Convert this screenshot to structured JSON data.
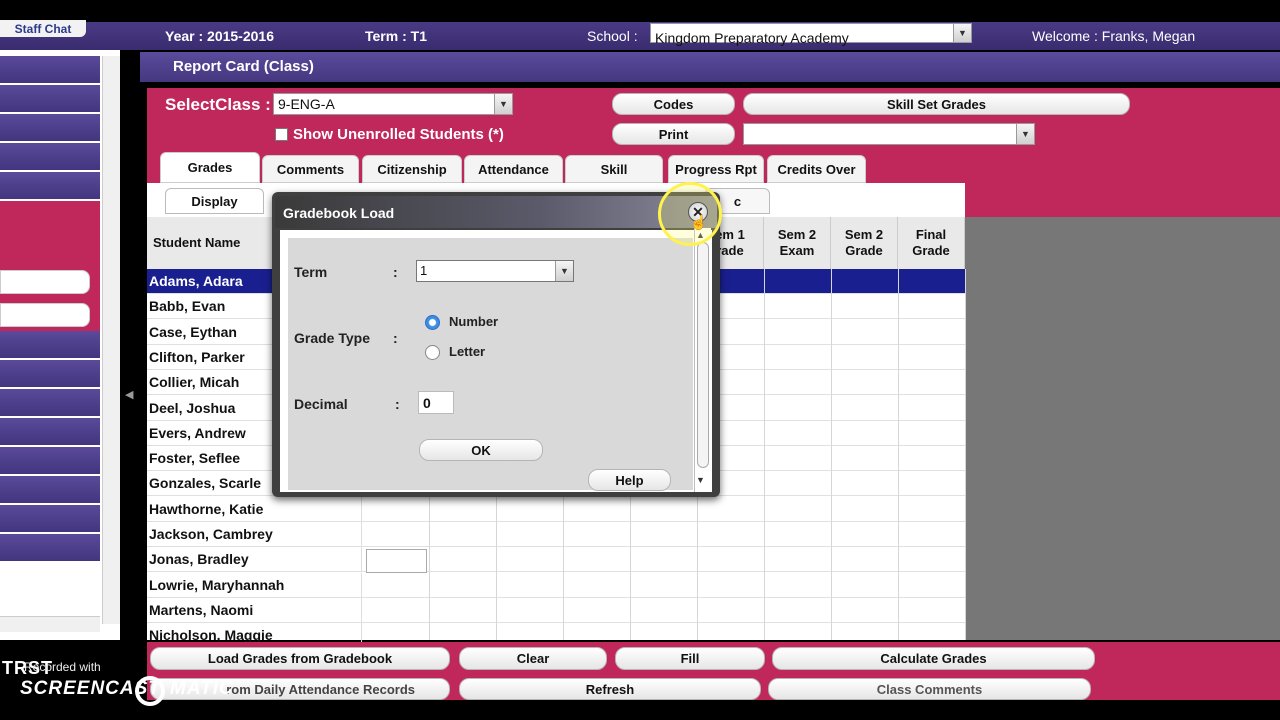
{
  "topbar": {
    "staff_chat": "Staff Chat",
    "year": "Year : 2015-2016",
    "term": "Term : T1",
    "school_label": "School :",
    "school_value": "Kingdom Preparatory Academy",
    "welcome": "Welcome : Franks, Megan"
  },
  "header": {
    "title": "Report Card (Class)"
  },
  "controls": {
    "select_class_label": "SelectClass :",
    "select_class_value": "9-ENG-A",
    "show_unenrolled": "Show Unenrolled Students (*)",
    "codes": "Codes",
    "skill_set_grades": "Skill Set Grades",
    "print": "Print"
  },
  "tabs": [
    "Grades",
    "Comments",
    "Citizenship",
    "Attendance",
    "Skill",
    "Progress Rpt",
    "Credits Over"
  ],
  "subtabs": {
    "display": "Display",
    "partial": "c"
  },
  "grid": {
    "student_name_header": "Student Name",
    "columns": [
      "Sem 1\nGrade",
      "Sem 2\nExam",
      "Sem 2\nGrade",
      "Final\nGrade"
    ],
    "partial_column": "em 1\nrade",
    "students": [
      "Adams, Adara",
      "Babb, Evan",
      "Case, Eythan",
      "Clifton, Parker",
      "Collier, Micah",
      "Deel, Joshua",
      "Evers, Andrew",
      "Foster, Seflee",
      "Gonzales, Scarle",
      "Hawthorne, Katie",
      "Jackson, Cambrey",
      "Jonas, Bradley",
      "Lowrie, Maryhannah",
      "Martens, Naomi",
      "Nicholson, Maggie"
    ],
    "selected_student": "Adams, Adara"
  },
  "bottom_buttons": {
    "load_gradebook": "Load Grades from Gradebook",
    "clear": "Clear",
    "fill": "Fill",
    "calculate": "Calculate Grades",
    "attendance": "rom Daily Attendance Records",
    "refresh": "Refresh",
    "class_comments": "Class Comments"
  },
  "dialog": {
    "title": "Gradebook Load",
    "term_label": "Term",
    "term_value": "1",
    "grade_type_label": "Grade Type",
    "colon": ":",
    "number": "Number",
    "letter": "Letter",
    "selected_grade_type": "Number",
    "decimal_label": "Decimal",
    "decimal_value": "0",
    "ok": "OK",
    "help": "Help",
    "close_icon": "close-icon"
  },
  "watermark": {
    "brand_partial": "TRST",
    "recorded_with": "Recorded with",
    "screencast": "SCREENCAST",
    "matic": "MATIC"
  },
  "colors": {
    "purple": "#45377f",
    "crimson": "#c0275a",
    "selected_row": "#1a1f8f",
    "grid_gray": "#777777"
  }
}
